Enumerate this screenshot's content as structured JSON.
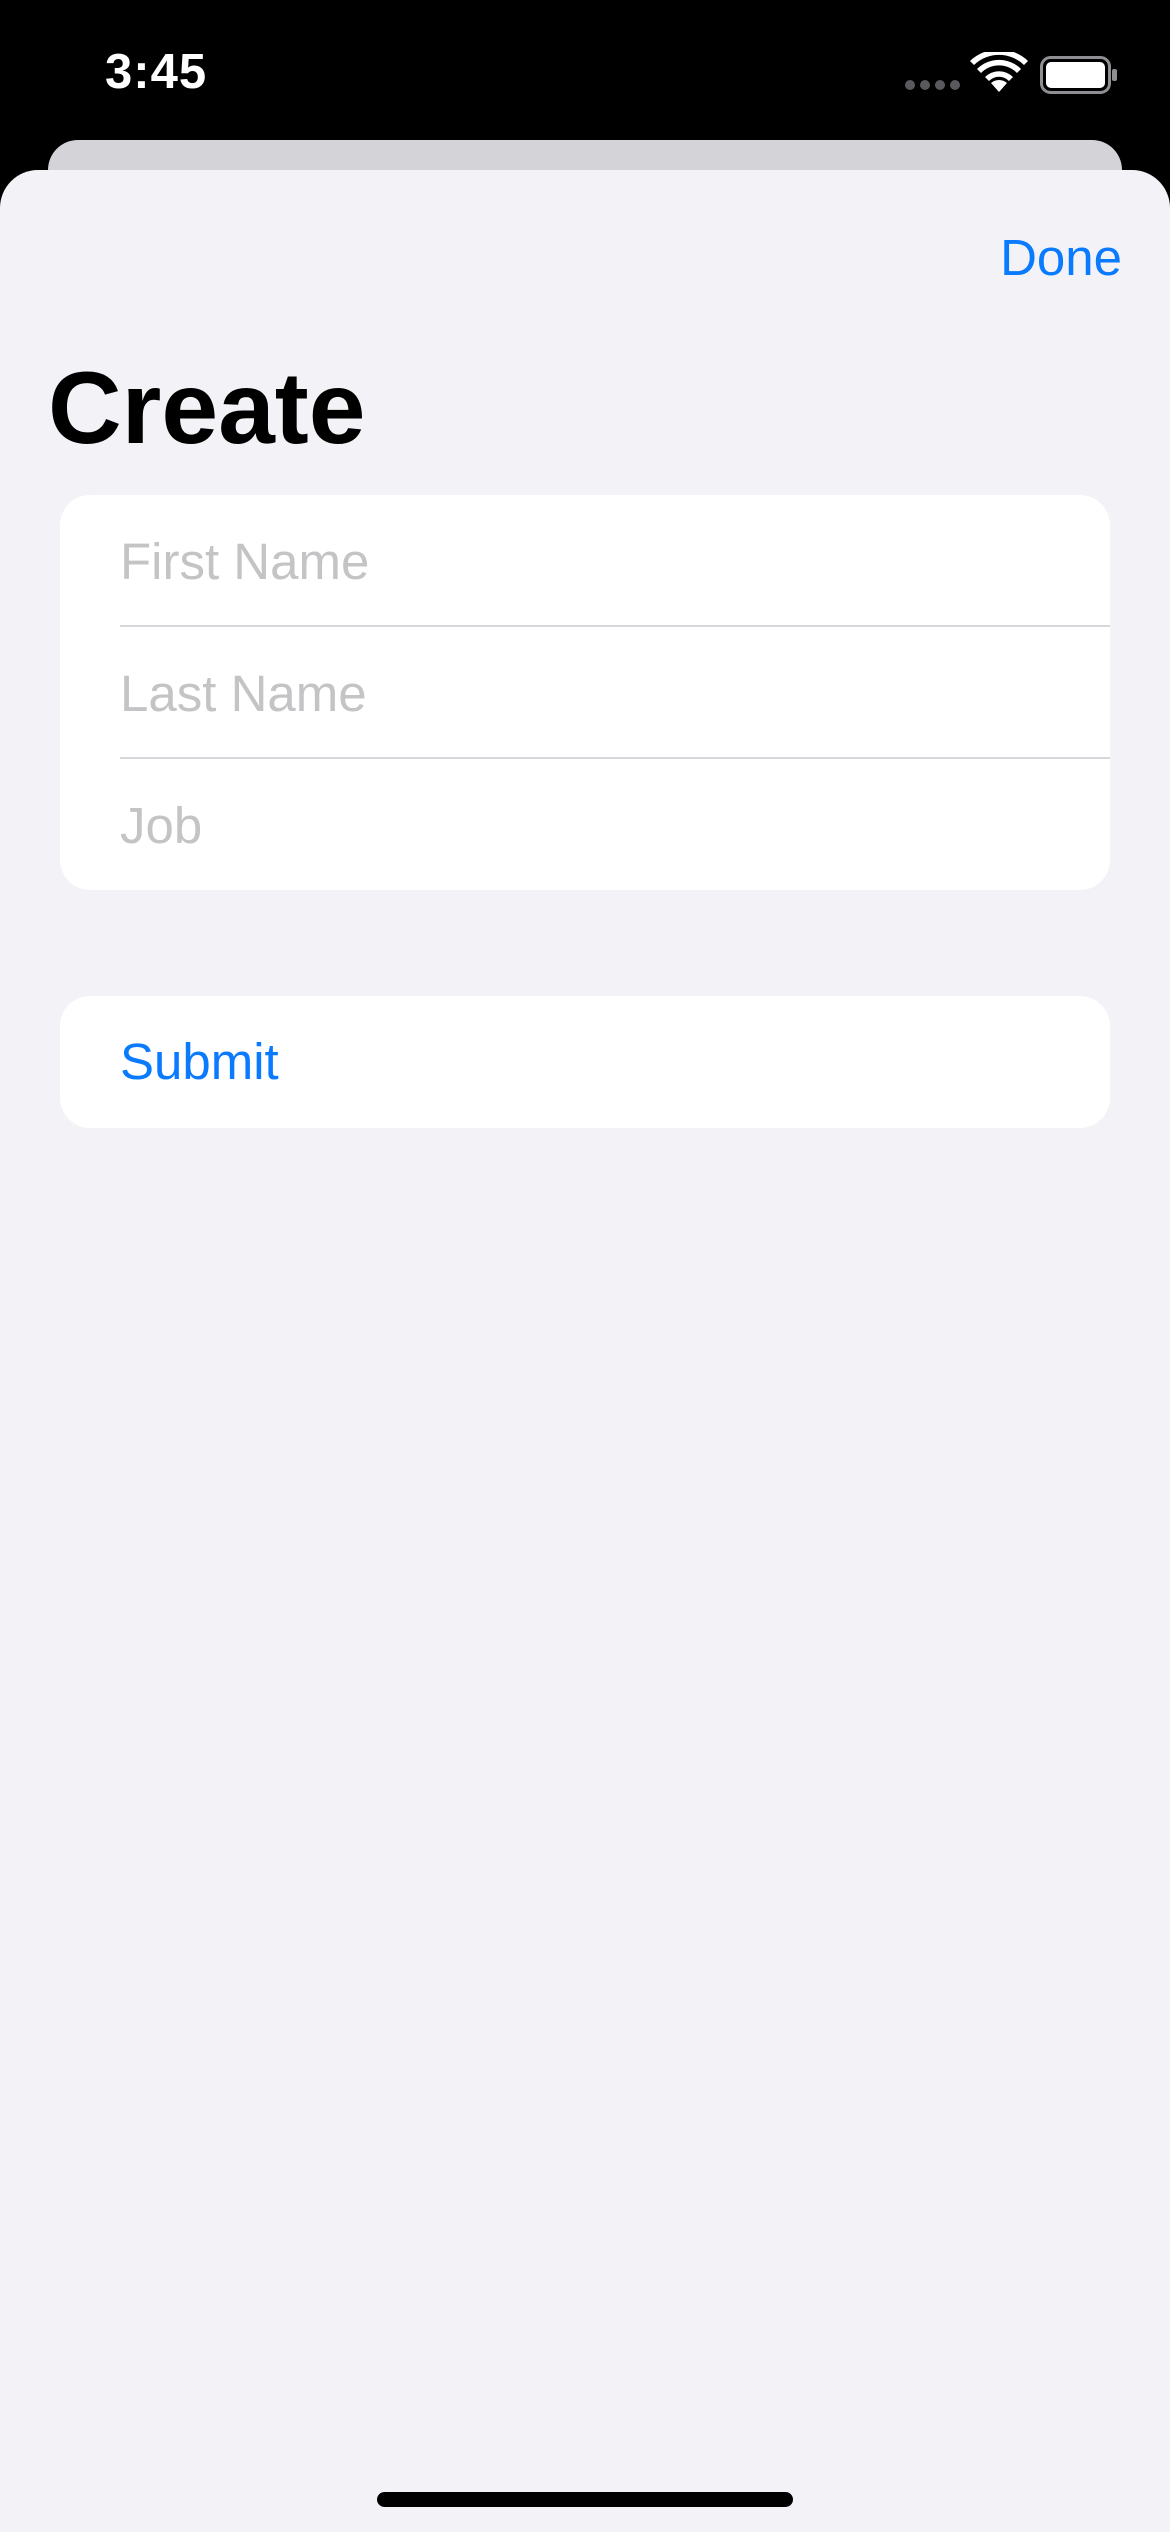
{
  "status_bar": {
    "time": "3:45",
    "signal_icon": "cellular-signal-icon",
    "wifi_icon": "wifi-icon",
    "battery_icon": "battery-icon"
  },
  "header": {
    "done_label": "Done",
    "title": "Create"
  },
  "form": {
    "fields": [
      {
        "name": "first-name",
        "placeholder": "First Name",
        "value": ""
      },
      {
        "name": "last-name",
        "placeholder": "Last Name",
        "value": ""
      },
      {
        "name": "job",
        "placeholder": "Job",
        "value": ""
      }
    ]
  },
  "actions": {
    "submit_label": "Submit"
  },
  "colors": {
    "accent": "#0a7aff",
    "sheet_background": "#f2f2f7",
    "placeholder": "#c4c4c6"
  }
}
